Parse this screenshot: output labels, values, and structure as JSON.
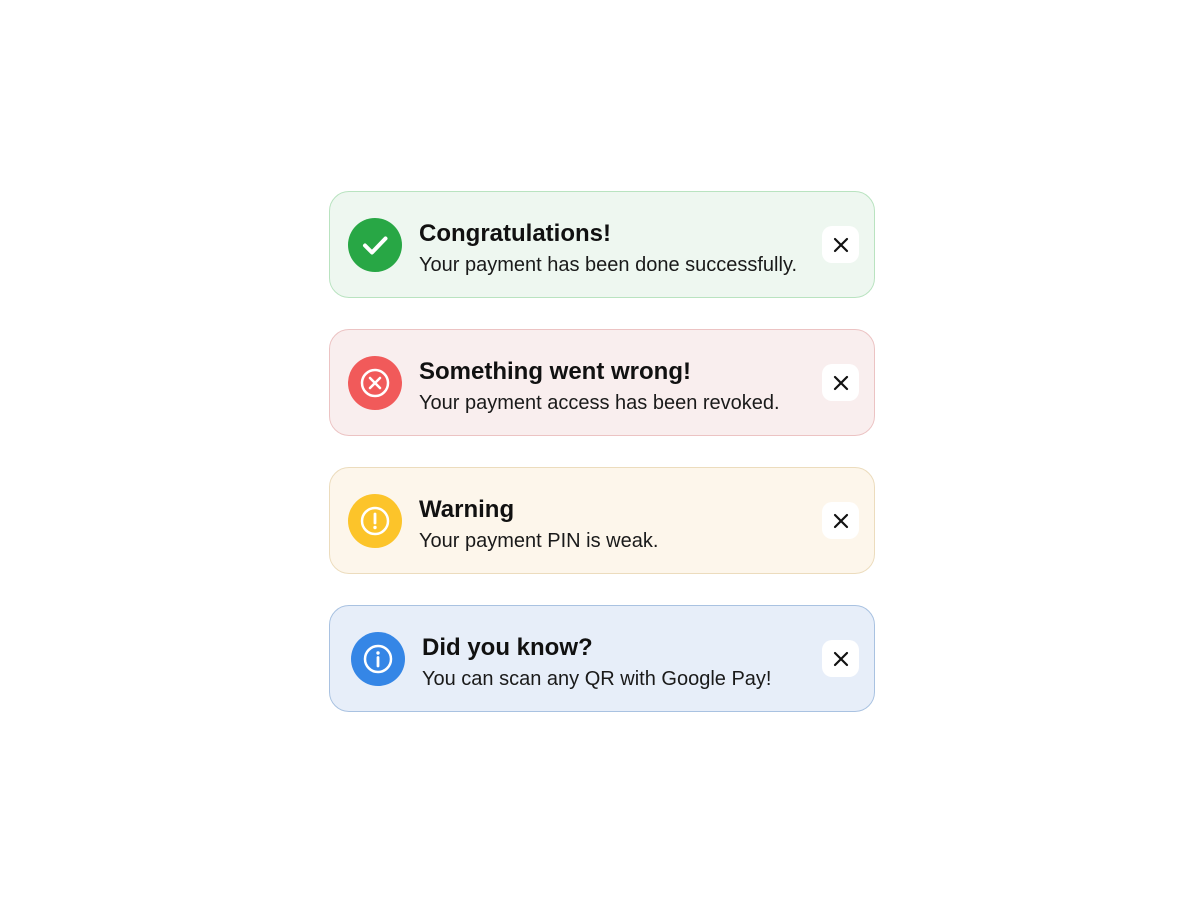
{
  "alerts": [
    {
      "type": "success",
      "title": "Congratulations!",
      "message": "Your payment has been done successfully.",
      "icon": "check-icon",
      "accent": "#28a745",
      "background": "#eef7f0"
    },
    {
      "type": "error",
      "title": "Something went wrong!",
      "message": "Your payment access has been revoked.",
      "icon": "error-x-circle-icon",
      "accent": "#f15a5a",
      "background": "#f9eeee"
    },
    {
      "type": "warning",
      "title": "Warning",
      "message": "Your payment PIN is weak.",
      "icon": "exclamation-circle-icon",
      "accent": "#fcc42a",
      "background": "#fdf6eb"
    },
    {
      "type": "info",
      "title": "Did you know?",
      "message": "You can scan any QR with Google Pay!",
      "icon": "info-circle-icon",
      "accent": "#3586e6",
      "background": "#e7eef9"
    }
  ],
  "close_icon": "close-icon"
}
